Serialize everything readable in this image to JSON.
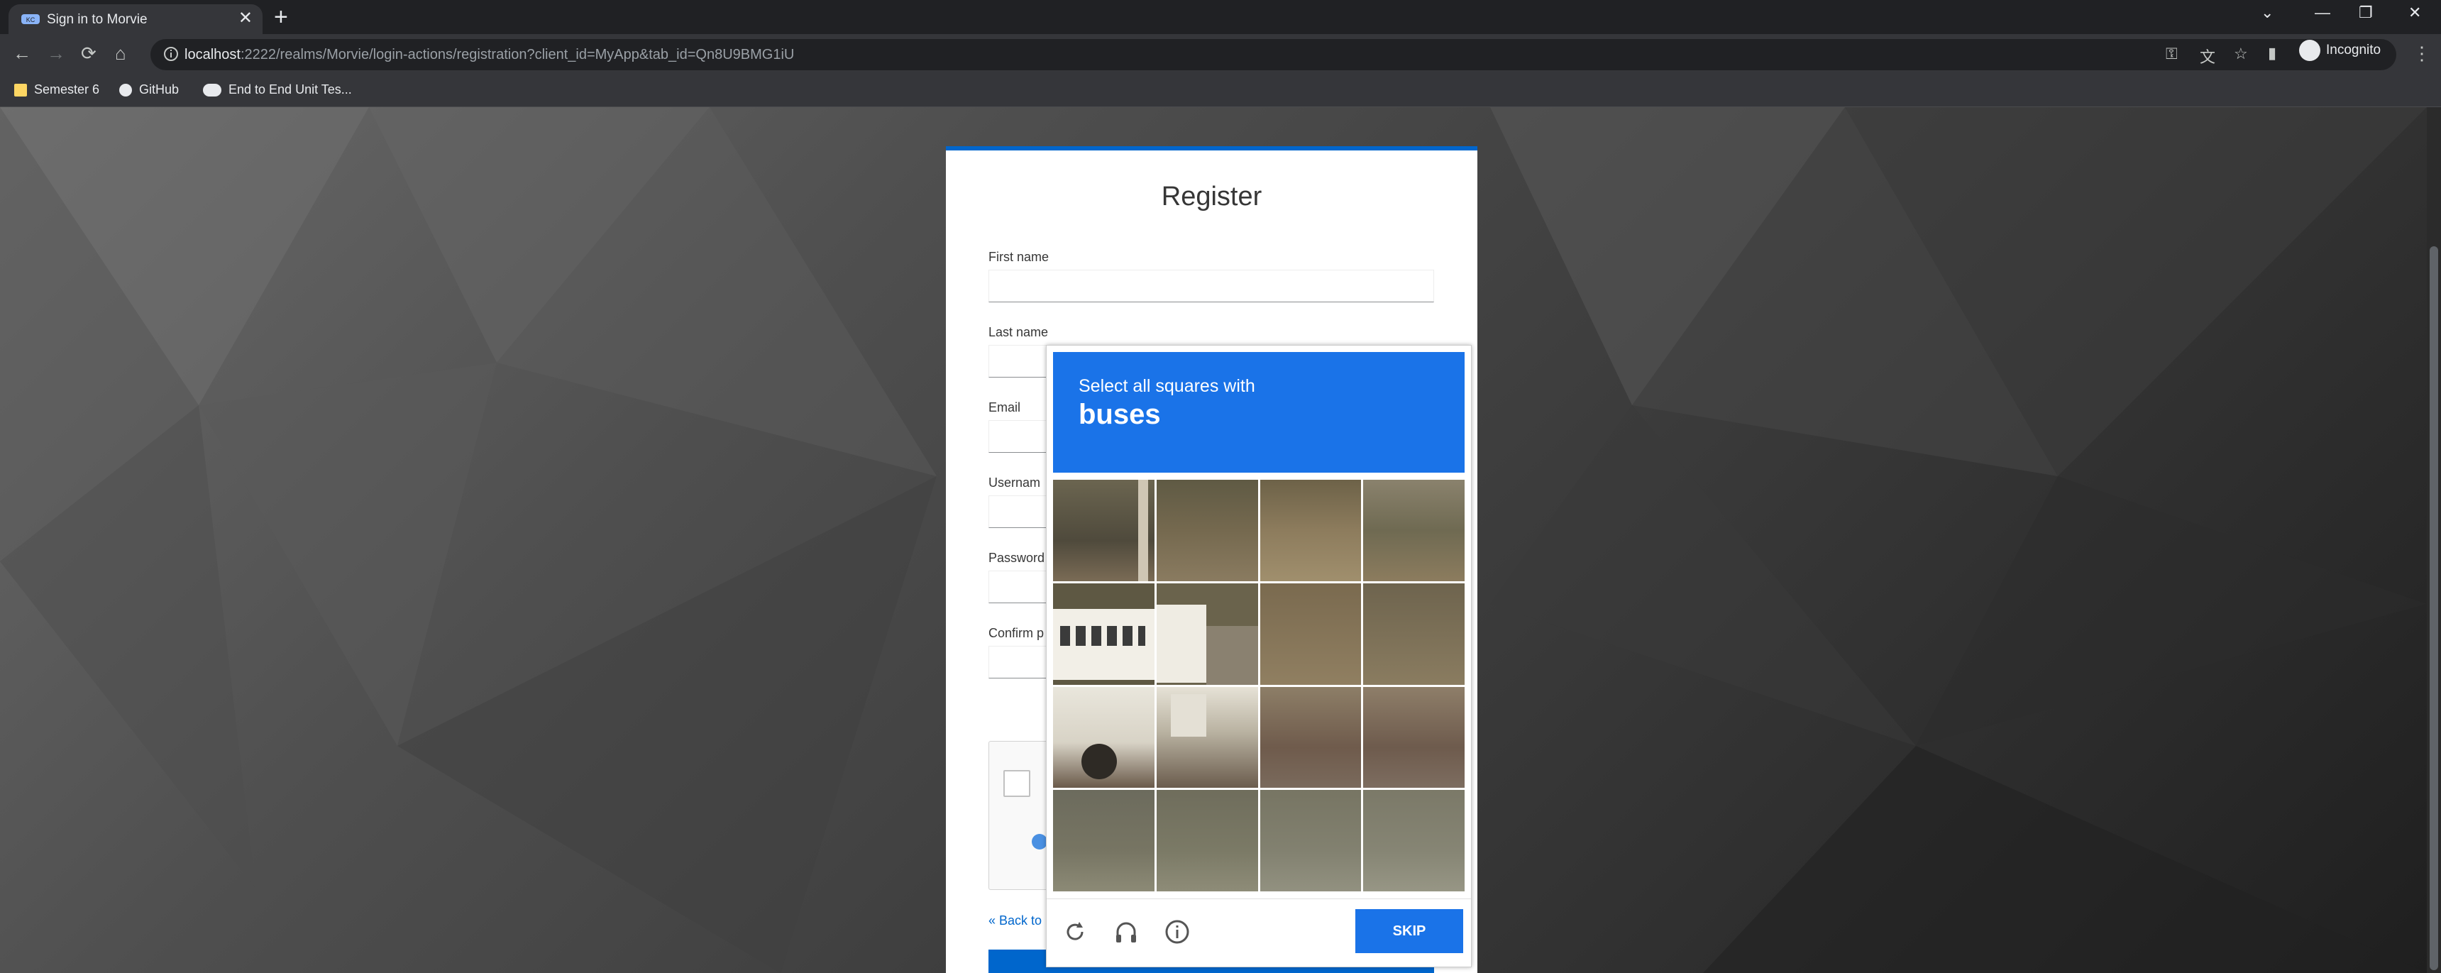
{
  "browser": {
    "tab_title": "Sign in to Morvie",
    "url_host": "localhost",
    "url_rest": ":2222/realms/Morvie/login-actions/registration?client_id=MyApp&tab_id=Qn8U9BMG1iU",
    "profile_label": "Incognito"
  },
  "bookmarks": [
    {
      "label": "Semester 6",
      "icon": "folder-icon"
    },
    {
      "label": "GitHub",
      "icon": "github-icon"
    },
    {
      "label": "End to End Unit Tes...",
      "icon": "medium-icon"
    }
  ],
  "form": {
    "title": "Register",
    "fields": [
      {
        "label": "First name",
        "value": ""
      },
      {
        "label": "Last name",
        "value": ""
      },
      {
        "label": "Email",
        "value": ""
      },
      {
        "label": "Usernam",
        "value": ""
      },
      {
        "label": "Password",
        "value": ""
      },
      {
        "label": "Confirm p",
        "value": ""
      }
    ],
    "back_link": "« Back to"
  },
  "captcha": {
    "instruction": "Select all squares with",
    "target": "buses",
    "skip_label": "SKIP",
    "icons": [
      "reload-icon",
      "audio-icon",
      "info-icon"
    ]
  },
  "colors": {
    "accent": "#0066cc",
    "captcha_blue": "#1a73e8"
  }
}
